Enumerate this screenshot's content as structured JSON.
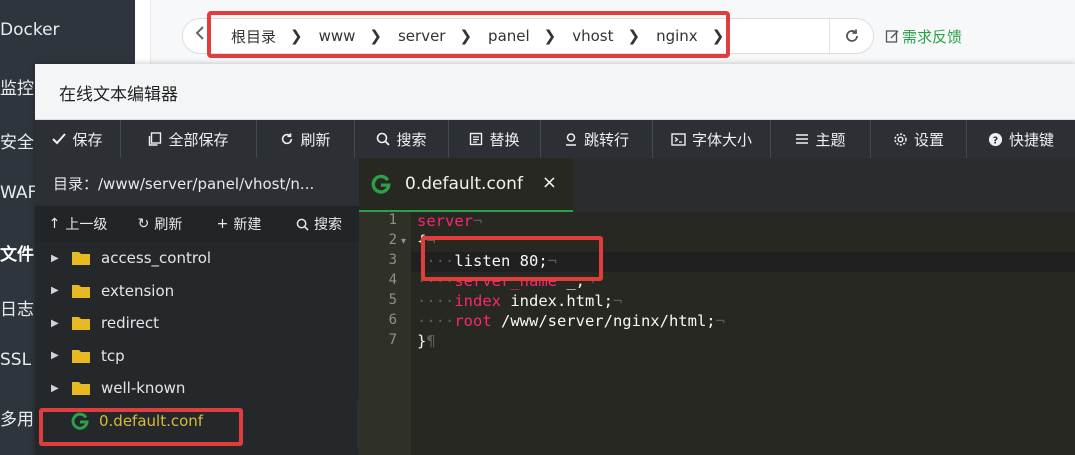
{
  "nav": {
    "items": [
      "Docker",
      "监控",
      "安全",
      "WAF",
      "文件",
      "日志",
      "SSL",
      "多用"
    ]
  },
  "breadcrumb": {
    "segments": [
      "根目录",
      "www",
      "server",
      "panel",
      "vhost",
      "nginx"
    ],
    "feedback_label": "需求反馈"
  },
  "editor": {
    "title": "在线文本编辑器",
    "toolbar": [
      {
        "label": "保存",
        "icon": "check-icon"
      },
      {
        "label": "全部保存",
        "icon": "copy-icon"
      },
      {
        "label": "刷新",
        "icon": "refresh-icon"
      },
      {
        "label": "搜索",
        "icon": "search-icon"
      },
      {
        "label": "替换",
        "icon": "replace-icon"
      },
      {
        "label": "跳转行",
        "icon": "location-icon"
      },
      {
        "label": "字体大小",
        "icon": "font-size-icon"
      },
      {
        "label": "主题",
        "icon": "menu-icon"
      },
      {
        "label": "设置",
        "icon": "gear-icon"
      },
      {
        "label": "快捷键",
        "icon": "help-icon"
      }
    ],
    "sidebar": {
      "dir_label": "目录：/www/server/panel/vhost/n...",
      "actions": [
        {
          "label": "上一级",
          "icon": "↑"
        },
        {
          "label": "刷新",
          "icon": "↻"
        },
        {
          "label": "新建",
          "icon": "+"
        },
        {
          "label": "搜索",
          "icon": "search"
        }
      ],
      "folders": [
        "access_control",
        "extension",
        "redirect",
        "tcp",
        "well-known"
      ],
      "files": [
        "0.default.conf"
      ]
    },
    "tab": {
      "name": "0.default.conf",
      "close": "×"
    },
    "line_numbers": [
      "1",
      "2",
      "3",
      "4",
      "5",
      "6",
      "7"
    ],
    "code": {
      "l1_kw": "server",
      "l2": "{",
      "l3_directive": "listen",
      "l3_value": " 80;",
      "l4_directive": "server_name",
      "l4_value": " _;",
      "l5_directive": "index",
      "l5_value": " index.html;",
      "l6_directive": "root",
      "l6_value": " /www/server/nginx/html;",
      "l7": "}"
    },
    "colors": {
      "accent": "#2aa146",
      "highlight": "#e23d3d",
      "keyword": "#f92672"
    }
  }
}
